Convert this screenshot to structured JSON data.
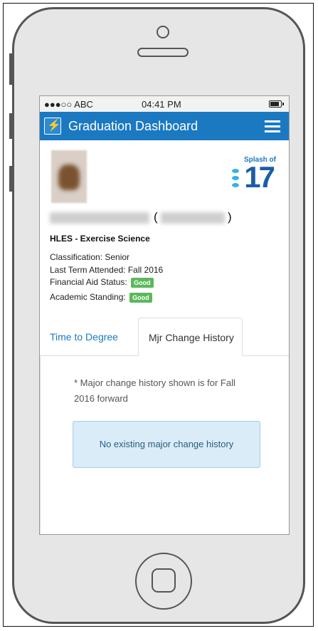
{
  "status_bar": {
    "carrier": "●●●○○ ABC",
    "time": "04:41 PM"
  },
  "app_bar": {
    "title": "Graduation Dashboard"
  },
  "logo": {
    "top_text": "Splash of",
    "number": "17"
  },
  "student": {
    "program": "HLES - Exercise Science",
    "classification": "Classification: Senior",
    "last_term": "Last Term Attended: Fall 2016",
    "financial_aid_label": "Financial Aid Status:",
    "financial_aid_value": "Good",
    "academic_label": "Academic Standing:",
    "academic_value": "Good",
    "id_open": "(",
    "id_close": ")"
  },
  "tabs": [
    {
      "label": "Time to Degree"
    },
    {
      "label": "Mjr Change History"
    }
  ],
  "content": {
    "note": "* Major change history shown is for Fall 2016 forward",
    "alert": "No existing major change history"
  },
  "colors": {
    "accent": "#1b79c2",
    "good_badge": "#5cb85c",
    "alert_bg": "#d9ecf7"
  }
}
